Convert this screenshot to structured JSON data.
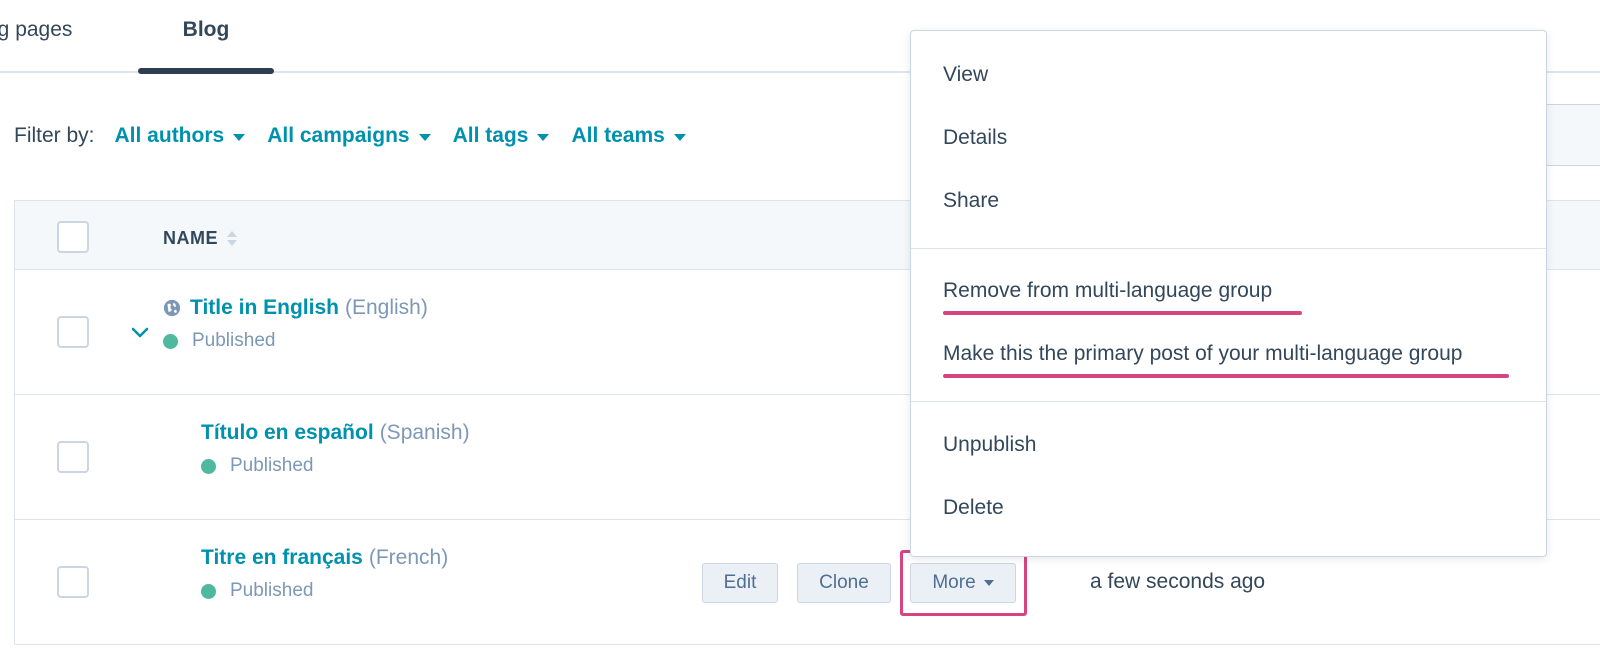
{
  "tabs": {
    "landing_pages": "ng pages",
    "blog": "Blog"
  },
  "filter": {
    "label": "Filter by:",
    "authors": "All authors",
    "campaigns": "All campaigns",
    "tags": "All tags",
    "teams": "All teams"
  },
  "table": {
    "name_header": "NAME",
    "rows": [
      {
        "title": "Title in English",
        "lang": "(English)",
        "status": "Published"
      },
      {
        "title": "Título en español",
        "lang": "(Spanish)",
        "status": "Published"
      },
      {
        "title": "Titre en français",
        "lang": "(French)",
        "status": "Published"
      }
    ]
  },
  "actions": {
    "edit": "Edit",
    "clone": "Clone",
    "more": "More",
    "updated": "a few seconds ago"
  },
  "menu": {
    "view": "View",
    "details": "Details",
    "share": "Share",
    "remove_group": "Remove from multi-language group",
    "make_primary": "Make this the primary post of your multi-language group",
    "unpublish": "Unpublish",
    "delete": "Delete"
  },
  "colors": {
    "link": "#0091ae",
    "published": "#4fb99f",
    "highlight": "#d6457f",
    "text": "#33475b"
  }
}
